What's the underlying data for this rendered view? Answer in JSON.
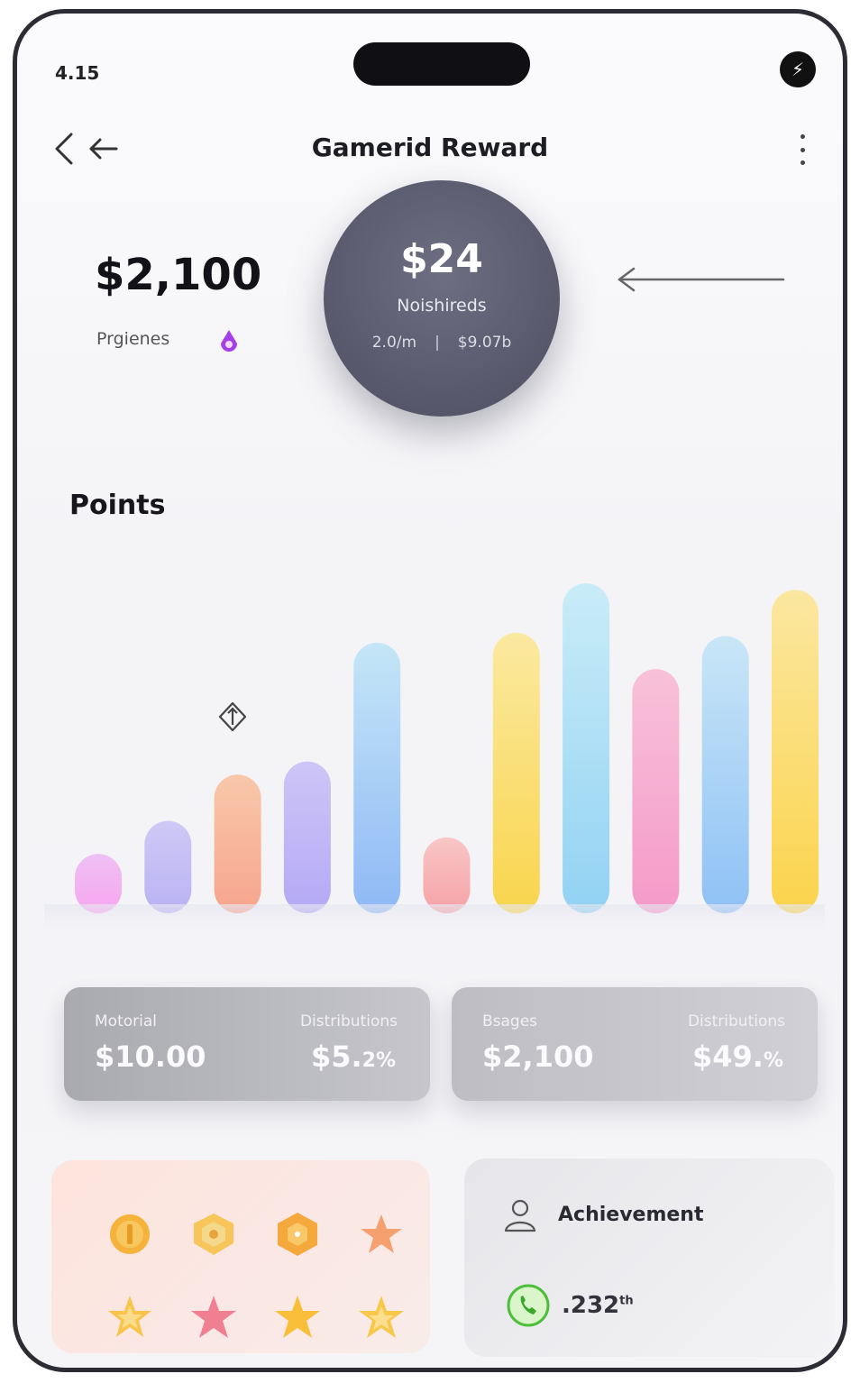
{
  "status": {
    "time": "4.15"
  },
  "header": {
    "title": "Gamerid Reward"
  },
  "balance": {
    "amount": "$2,100",
    "label": "Prgienes"
  },
  "circle": {
    "amount": "$24",
    "label": "Noishireds",
    "stat_left": "2.0/m",
    "stat_right": "$9.07b"
  },
  "points": {
    "title": "Points"
  },
  "chart_data": {
    "type": "bar",
    "values": [
      18,
      28,
      42,
      46,
      82,
      23,
      85,
      100,
      74,
      84,
      98
    ],
    "colors": [
      [
        "#f7a6ef",
        "#eec0f4"
      ],
      [
        "#b9b2f3",
        "#cfc9f6"
      ],
      [
        "#f7a58f",
        "#f8c7a9"
      ],
      [
        "#b4a9f5",
        "#cec5f7"
      ],
      [
        "#8fb9f6",
        "#c5e6f7"
      ],
      [
        "#f6a2a7",
        "#f9c6c6"
      ],
      [
        "#f9d54d",
        "#fbe9a0"
      ],
      [
        "#92d2f3",
        "#c9ecf7"
      ],
      [
        "#f59ac9",
        "#f8c1d9"
      ],
      [
        "#8ec1f5",
        "#c9e6f7"
      ],
      [
        "#fbd44c",
        "#fbe7a0"
      ]
    ]
  },
  "cards": [
    {
      "label1": "Motorial",
      "label2": "Distributions",
      "value1": "$10.00",
      "value2": "$5.",
      "value2_small": "2%"
    },
    {
      "label1": "Bsages",
      "label2": "Distributions",
      "value1": "$2,100",
      "value2": "$49.",
      "value2_small": "%"
    }
  ],
  "achievement": {
    "title": "Achievement",
    "value": ".232",
    "value_sup": "th"
  }
}
